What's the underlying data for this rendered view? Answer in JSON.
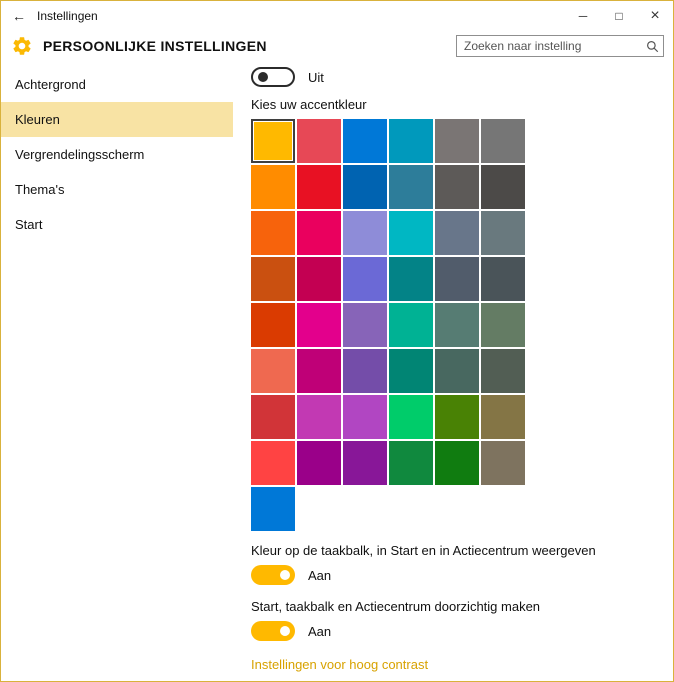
{
  "window": {
    "title": "Instellingen",
    "back_glyph": "←",
    "controls": {
      "minimize": "─",
      "maximize": "□",
      "close": "×"
    }
  },
  "header": {
    "title": "PERSOONLIJKE INSTELLINGEN",
    "search": {
      "placeholder": "Zoeken naar instelling"
    }
  },
  "sidebar": {
    "items": [
      {
        "label": "Achtergrond",
        "selected": false
      },
      {
        "label": "Kleuren",
        "selected": true
      },
      {
        "label": "Vergrendelingsscherm",
        "selected": false
      },
      {
        "label": "Thema's",
        "selected": false
      },
      {
        "label": "Start",
        "selected": false
      }
    ]
  },
  "content": {
    "auto_accent_toggle": {
      "label": "Uit",
      "on": false
    },
    "accent_picker_label": "Kies uw accentkleur",
    "selected_color_index": 0,
    "accent_colors": [
      "#ffb900",
      "#e74856",
      "#0078d7",
      "#0099bc",
      "#7a7574",
      "#767676",
      "#ff8c00",
      "#e81123",
      "#0063b1",
      "#2d7d9a",
      "#5d5a58",
      "#4c4a48",
      "#f7630c",
      "#ea005e",
      "#8e8cd8",
      "#00b7c3",
      "#68768a",
      "#69797e",
      "#ca5010",
      "#c30052",
      "#6b69d6",
      "#038387",
      "#515c6b",
      "#4a5459",
      "#da3b01",
      "#e3008c",
      "#8764b8",
      "#00b294",
      "#567c73",
      "#647c64",
      "#ef6950",
      "#bf0077",
      "#744da9",
      "#018574",
      "#486860",
      "#525e54",
      "#d13438",
      "#c239b3",
      "#b146c2",
      "#00cc6a",
      "#498205",
      "#847545",
      "#ff4343",
      "#9a0089",
      "#881798",
      "#10893e",
      "#107c10",
      "#7e735f",
      "#0078d7"
    ],
    "show_color_label": "Kleur op de taakbalk, in Start en in Actiecentrum weergeven",
    "show_color_toggle": {
      "label": "Aan",
      "on": true
    },
    "transparency_label": "Start, taakbalk en Actiecentrum doorzichtig maken",
    "transparency_toggle": {
      "label": "Aan",
      "on": true
    },
    "high_contrast_link": "Instellingen voor hoog contrast"
  },
  "colors": {
    "accent": "#ffb900",
    "sidebar_highlight": "#f8e3a4",
    "link": "#d8a200",
    "window_border": "#d9b23c"
  }
}
